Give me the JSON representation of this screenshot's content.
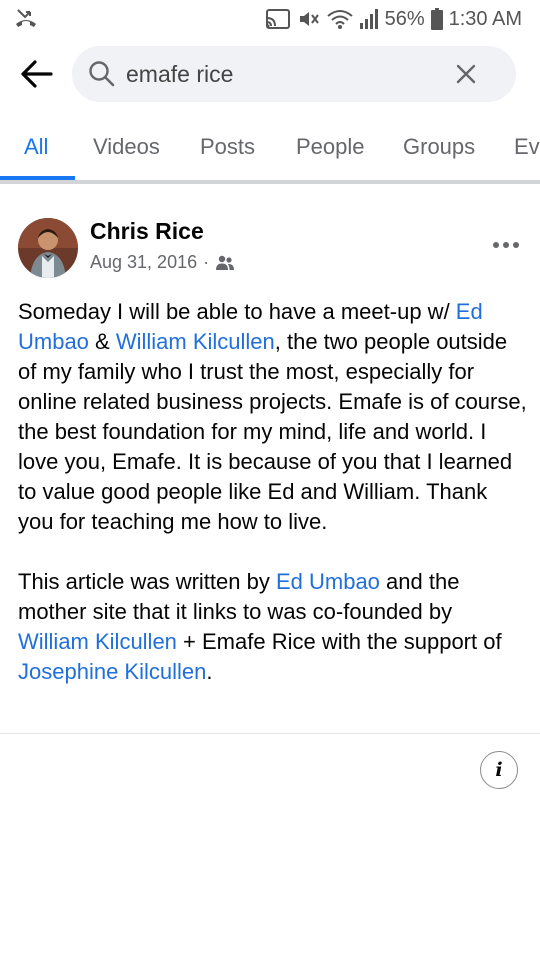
{
  "status_bar": {
    "battery": "56%",
    "time": "1:30 AM",
    "icons": [
      "missed-call-icon",
      "cast-icon",
      "mute-icon",
      "wifi-icon",
      "signal-icon",
      "battery-icon"
    ]
  },
  "search": {
    "query": "emafe rice"
  },
  "tabs": [
    {
      "label": "All",
      "active": true
    },
    {
      "label": "Videos",
      "active": false
    },
    {
      "label": "Posts",
      "active": false
    },
    {
      "label": "People",
      "active": false
    },
    {
      "label": "Groups",
      "active": false
    },
    {
      "label": "Ev",
      "active": false
    }
  ],
  "post": {
    "author": "Chris Rice",
    "date": "Aug 31, 2016",
    "separator": "·",
    "privacy_icon": "friends-icon",
    "p1_a": "Someday I will be able to have a meet-up w/ ",
    "p1_link1": "Ed Umbao",
    "p1_b": " & ",
    "p1_link2": "William Kilcullen",
    "p1_c": ", the two people outside of my family who I trust the most, especially for online related business projects. Emafe is of course, the best foundation for my mind, life and world. I love you, Emafe. It is because of you that I learned to value good people like Ed and William. Thank you for teaching me how to live.",
    "p2_a": "This article was written by ",
    "p2_link1": "Ed Umbao",
    "p2_b": " and the mother site that it links to was co-founded by ",
    "p2_link2": "William Kilcullen",
    "p2_c": " + Emafe Rice with the support of ",
    "p2_link3": "Josephine Kilcullen",
    "p2_d": "."
  },
  "info_button": "i",
  "colors": {
    "accent": "#1877f2",
    "link": "#216fdb",
    "search_bg": "#f0f2f5",
    "muted_text": "#65676b"
  }
}
